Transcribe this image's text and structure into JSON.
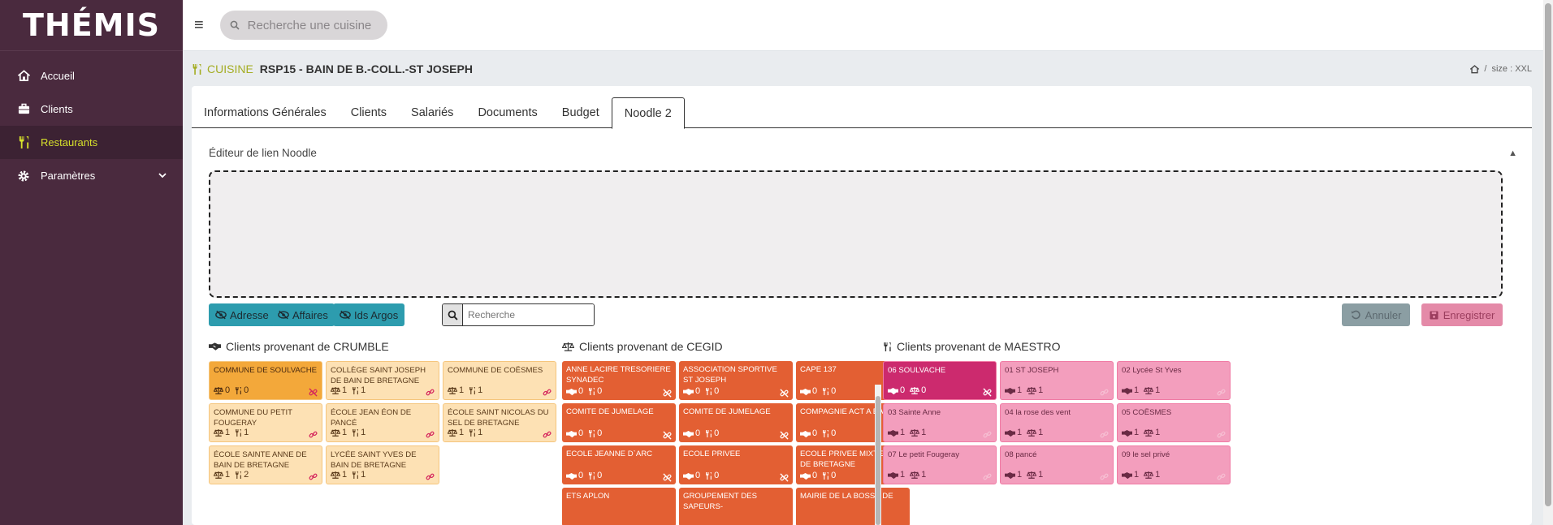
{
  "app": {
    "logo": "THÉMIS"
  },
  "sidebar": {
    "items": [
      {
        "label": "Accueil",
        "icon": "home-icon"
      },
      {
        "label": "Clients",
        "icon": "briefcase-icon"
      },
      {
        "label": "Restaurants",
        "icon": "utensils-icon",
        "active": true
      },
      {
        "label": "Paramètres",
        "icon": "gear-icon",
        "has_children": true
      }
    ]
  },
  "topbar": {
    "search_placeholder": "Recherche une cuisine"
  },
  "header": {
    "kind": "CUISINE",
    "title": "RSP15 - BAIN DE B.-COLL.-ST JOSEPH",
    "breadcrumb_sep": "/",
    "size_label": "size : XXL"
  },
  "tabs": [
    {
      "label": "Informations Générales"
    },
    {
      "label": "Clients"
    },
    {
      "label": "Salariés"
    },
    {
      "label": "Documents"
    },
    {
      "label": "Budget"
    },
    {
      "label": "Noodle 2",
      "active": true
    }
  ],
  "editor": {
    "title": "Éditeur de lien Noodle"
  },
  "toolbar": {
    "adresse": "Adresse",
    "affaires": "Affaires",
    "ids_argos": "Ids Argos",
    "search_placeholder": "Recherche",
    "annuler": "Annuler",
    "enregistrer": "Enregistrer"
  },
  "columns": {
    "crumble": {
      "title": "Clients provenant de CRUMBLE",
      "tiles": [
        {
          "name": "COMMUNE DE SOULVACHE",
          "a": "0",
          "b": "0",
          "linked": false,
          "selected": true
        },
        {
          "name": "COLLÈGE SAINT JOSEPH DE BAIN DE BRETAGNE",
          "a": "1",
          "b": "1",
          "linked": true
        },
        {
          "name": "COMMUNE DE COËSMES",
          "a": "1",
          "b": "1",
          "linked": true
        },
        {
          "name": "COMMUNE DU PETIT FOUGERAY",
          "a": "1",
          "b": "1",
          "linked": true
        },
        {
          "name": "ÉCOLE JEAN ÉON DE PANCÉ",
          "a": "1",
          "b": "1",
          "linked": true
        },
        {
          "name": "ÉCOLE SAINT NICOLAS DU SEL DE BRETAGNE",
          "a": "1",
          "b": "1",
          "linked": true
        },
        {
          "name": "ÉCOLE SAINTE ANNE DE BAIN DE BRETAGNE",
          "a": "1",
          "b": "2",
          "linked": true
        },
        {
          "name": "LYCÉE SAINT YVES DE BAIN DE BRETAGNE",
          "a": "1",
          "b": "1",
          "linked": true
        }
      ]
    },
    "cegid": {
      "title": "Clients provenant de CEGID",
      "tiles": [
        {
          "name": "ANNE LACIRE TRESORIERE SYNADEC",
          "a": "0",
          "b": "0"
        },
        {
          "name": "ASSOCIATION SPORTIVE ST JOSEPH",
          "a": "0",
          "b": "0"
        },
        {
          "name": "CAPE 137",
          "a": "0",
          "b": "0"
        },
        {
          "name": "COMITE DE JUMELAGE",
          "a": "0",
          "b": "0"
        },
        {
          "name": "COMITE DE JUMELAGE",
          "a": "0",
          "b": "0"
        },
        {
          "name": "COMPAGNIE ACT A BAIN",
          "a": "0",
          "b": "0"
        },
        {
          "name": "ECOLE JEANNE D`ARC",
          "a": "0",
          "b": "0"
        },
        {
          "name": "ECOLE PRIVEE",
          "a": "0",
          "b": "0"
        },
        {
          "name": "ECOLE PRIVEE MIXTE-SEL DE BRETAGNE",
          "a": "0",
          "b": "0"
        },
        {
          "name": "ETS APLON",
          "a": "",
          "b": ""
        },
        {
          "name": "GROUPEMENT DES SAPEURS-",
          "a": "",
          "b": ""
        },
        {
          "name": "MAIRIE DE LA BOSSE DE",
          "a": "",
          "b": ""
        }
      ]
    },
    "maestro": {
      "title": "Clients provenant de MAESTRO",
      "tiles": [
        {
          "name": "06 SOULVACHE",
          "a": "0",
          "b": "0",
          "selected": true,
          "linked": false
        },
        {
          "name": "01 ST JOSEPH",
          "a": "1",
          "b": "1",
          "linked": true
        },
        {
          "name": "02 Lycée St Yves",
          "a": "1",
          "b": "1",
          "linked": true
        },
        {
          "name": "03 Sainte Anne",
          "a": "1",
          "b": "1",
          "linked": true
        },
        {
          "name": "04 la rose des vent",
          "a": "1",
          "b": "1",
          "linked": true
        },
        {
          "name": "05 COËSMES",
          "a": "1",
          "b": "1",
          "linked": true
        },
        {
          "name": "07 Le petit Fougeray",
          "a": "1",
          "b": "1",
          "linked": true
        },
        {
          "name": "08 pancé",
          "a": "1",
          "b": "1",
          "linked": true
        },
        {
          "name": "09 le sel privé",
          "a": "1",
          "b": "1",
          "linked": true
        }
      ]
    }
  },
  "colors": {
    "sidebar_bg": "#4a2a3e",
    "active_accent": "#d6e02b",
    "crumble_tile": "#fde1b4",
    "crumble_selected": "#f3a83a",
    "cegid_tile": "#e35f33",
    "maestro_tile": "#f39ebd",
    "maestro_selected": "#cc2a6e",
    "toolbar_btn": "#2d9cae"
  }
}
